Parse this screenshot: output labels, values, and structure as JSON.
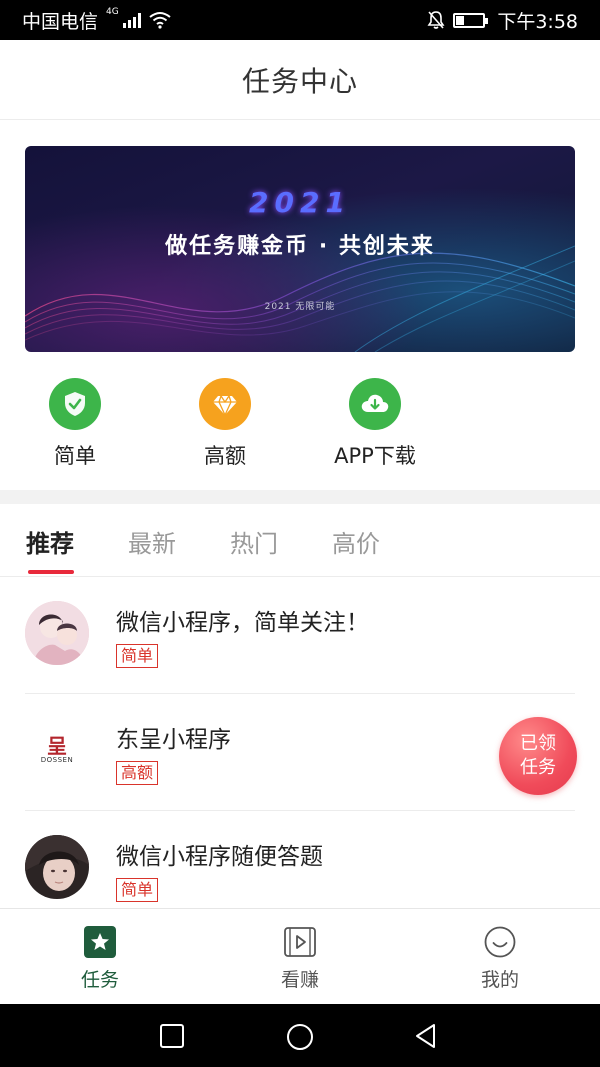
{
  "status_bar": {
    "carrier": "中国电信",
    "network": "4G",
    "time": "下午3:58",
    "icons": [
      "signal-icon",
      "wifi-icon",
      "mute-icon",
      "battery-icon"
    ]
  },
  "header": {
    "title": "任务中心"
  },
  "banner": {
    "year": "2021",
    "slogan": "做任务赚金币 · 共创未来",
    "subtitle": "2021 无限可能"
  },
  "shortcuts": [
    {
      "label": "简单",
      "icon": "shield-check-icon",
      "color": "#3db54a"
    },
    {
      "label": "高额",
      "icon": "diamond-icon",
      "color": "#f6a21e"
    },
    {
      "label": "APP下载",
      "icon": "cloud-download-icon",
      "color": "#3db54a"
    }
  ],
  "tabs": [
    {
      "label": "推荐",
      "active": true
    },
    {
      "label": "最新",
      "active": false
    },
    {
      "label": "热门",
      "active": false
    },
    {
      "label": "高价",
      "active": false
    }
  ],
  "tasks": [
    {
      "title": "微信小程序，简单关注！",
      "tag": "简单",
      "avatar": "illustration-avatar"
    },
    {
      "title": "东呈小程序",
      "tag": "高额",
      "avatar": "dossen-logo",
      "logo_text": "呈",
      "logo_caption": "DOSSEN"
    },
    {
      "title": "微信小程序随便答题",
      "tag": "简单",
      "avatar": "photo-avatar"
    }
  ],
  "claimed_badge": {
    "line1": "已领",
    "line2": "任务"
  },
  "bottom_nav": [
    {
      "label": "任务",
      "icon": "task-star-icon",
      "active": true
    },
    {
      "label": "看赚",
      "icon": "video-play-icon",
      "active": false
    },
    {
      "label": "我的",
      "icon": "smile-icon",
      "active": false
    }
  ],
  "colors": {
    "accent": "#e8293b",
    "tag_red": "#d9342b",
    "nav_active": "#1f5c3c",
    "green": "#3db54a",
    "orange": "#f6a21e"
  }
}
